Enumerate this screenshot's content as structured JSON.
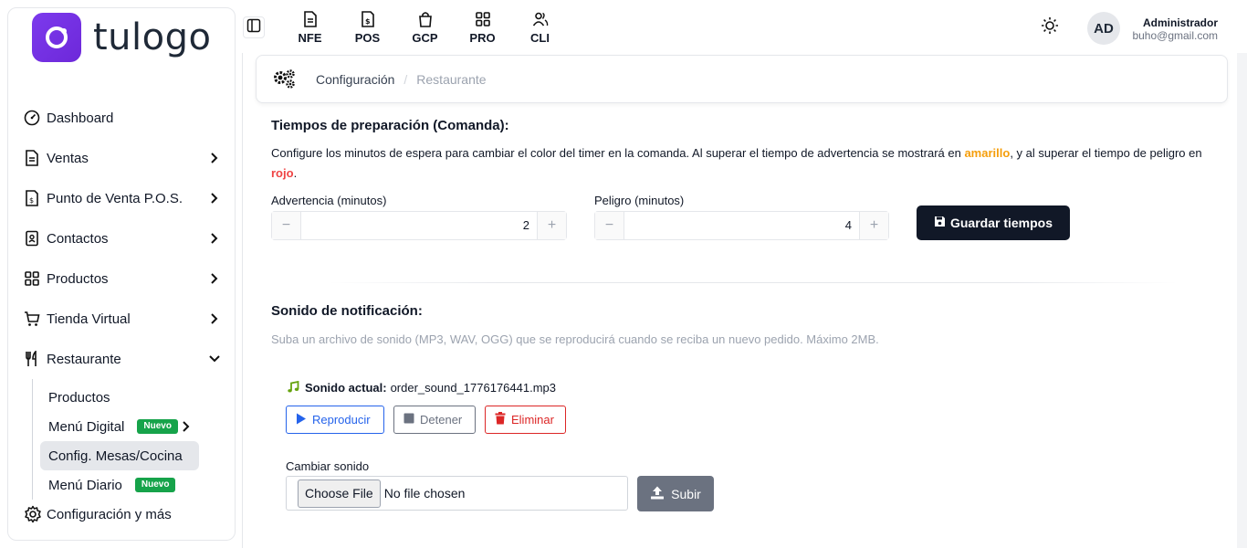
{
  "brand": {
    "name": "tulogo",
    "accent": "#7c3aed"
  },
  "sidebar": {
    "items": [
      {
        "label": "Dashboard",
        "icon": "gauge-icon"
      },
      {
        "label": "Ventas",
        "icon": "document-icon"
      },
      {
        "label": "Punto de Venta P.O.S.",
        "icon": "pos-receipt-icon"
      },
      {
        "label": "Contactos",
        "icon": "contacts-icon"
      },
      {
        "label": "Productos",
        "icon": "grid-icon"
      },
      {
        "label": "Tienda Virtual",
        "icon": "cart-icon"
      },
      {
        "label": "Restaurante",
        "icon": "fork-knife-icon"
      }
    ],
    "restaurant_sub": [
      {
        "label": "Productos"
      },
      {
        "label": "Menú Digital",
        "badge": "Nuevo"
      },
      {
        "label": "Config. Mesas/Cocina"
      },
      {
        "label": "Menú Diario",
        "badge": "Nuevo"
      }
    ],
    "bottom": {
      "label": "Configuración y más",
      "icon": "gear-icon"
    }
  },
  "topnav": [
    {
      "label": "NFE",
      "icon": "invoice-icon"
    },
    {
      "label": "POS",
      "icon": "receipt-dollar-icon"
    },
    {
      "label": "GCP",
      "icon": "shopping-bag-icon"
    },
    {
      "label": "PRO",
      "icon": "grid-icon"
    },
    {
      "label": "CLI",
      "icon": "users-icon"
    }
  ],
  "user": {
    "initials": "AD",
    "name": "Administrador",
    "email": "buho@gmail.com"
  },
  "breadcrumb": {
    "first": "Configuración",
    "separator": "/",
    "current": "Restaurante"
  },
  "prep": {
    "title": "Tiempos de preparación (Comanda):",
    "desc_1": "Configure los minutos de espera para cambiar el color del timer en la comanda. Al superar el tiempo de advertencia se mostrará en ",
    "warn_word": "amarillo",
    "desc_2": ", y al superar el tiempo de peligro en ",
    "danger_word": "rojo",
    "desc_3": ".",
    "warning_label": "Advertencia (minutos)",
    "warning_value": "2",
    "danger_label": "Peligro (minutos)",
    "danger_value": "4",
    "minus": "−",
    "plus": "+",
    "save_label": "Guardar tiempos"
  },
  "sound": {
    "title": "Sonido de notificación:",
    "desc": "Suba un archivo de sonido (MP3, WAV, OGG) que se reproducirá cuando se reciba un nuevo pedido. Máximo 2MB.",
    "current_label": "Sonido actual:",
    "current_file": "order_sound_1776176441.mp3",
    "play_label": "Reproducir",
    "stop_label": "Detener",
    "delete_label": "Eliminar",
    "change_label": "Cambiar sonido",
    "choose_file_label": "Choose File",
    "no_file_text": "No file chosen",
    "upload_label": "Subir"
  }
}
